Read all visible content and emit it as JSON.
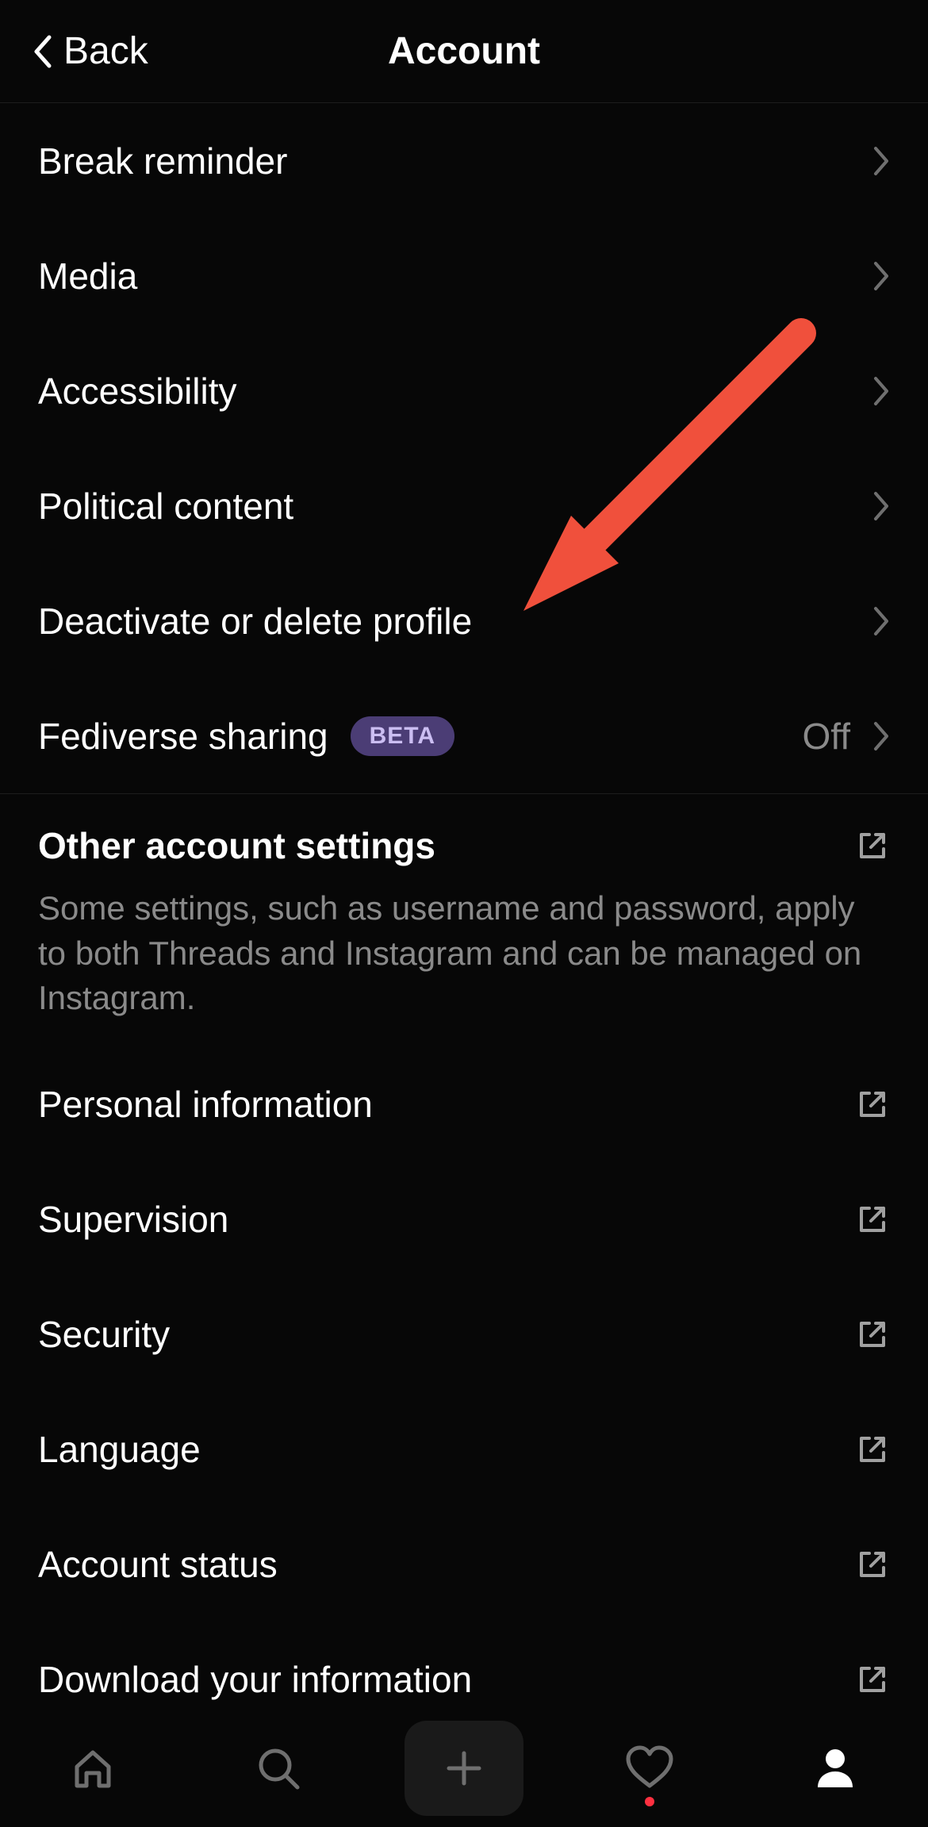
{
  "header": {
    "back_label": "Back",
    "title": "Account"
  },
  "settings": {
    "items": [
      {
        "label": "Break reminder"
      },
      {
        "label": "Media"
      },
      {
        "label": "Accessibility"
      },
      {
        "label": "Political content"
      },
      {
        "label": "Deactivate or delete profile"
      },
      {
        "label": "Fediverse sharing",
        "badge": "BETA",
        "value": "Off"
      }
    ]
  },
  "other_section": {
    "title": "Other account settings",
    "description": "Some settings, such as username and password, apply to both Threads and Instagram and can be managed on Instagram.",
    "items": [
      {
        "label": "Personal information"
      },
      {
        "label": "Supervision"
      },
      {
        "label": "Security"
      },
      {
        "label": "Language"
      },
      {
        "label": "Account status"
      },
      {
        "label": "Download your information"
      }
    ]
  },
  "tabs": {
    "home": "home",
    "search": "search",
    "create": "create",
    "activity": "activity",
    "profile": "profile",
    "active": "profile",
    "activity_badge": true
  },
  "annotation": {
    "arrow_color": "#f0503c"
  }
}
